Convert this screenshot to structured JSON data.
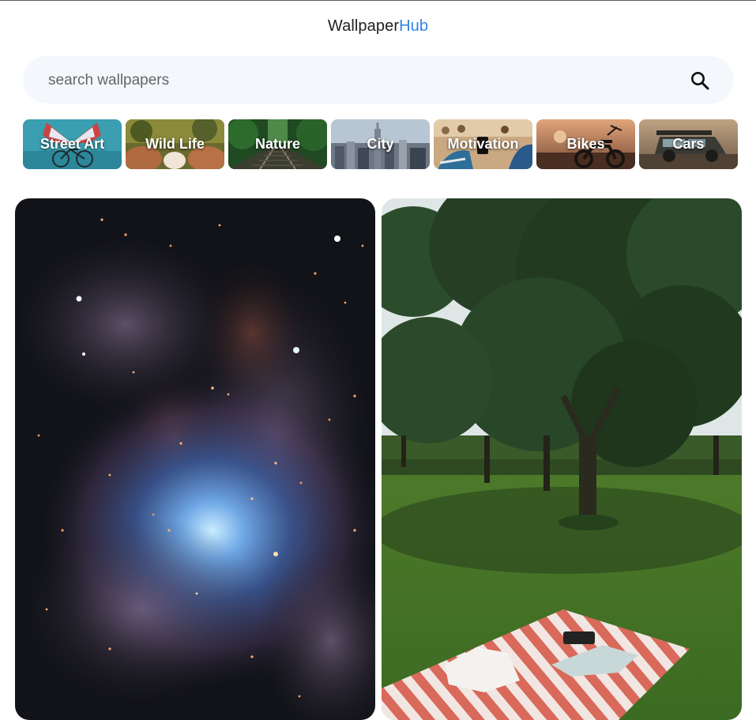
{
  "header": {
    "title_main": "Wallpaper",
    "title_accent": "Hub",
    "accent_color": "#2e86e6"
  },
  "search": {
    "placeholder": "search wallpapers",
    "value": "",
    "icon": "search-icon"
  },
  "categories": [
    {
      "label": "Street Art"
    },
    {
      "label": "Wild Life"
    },
    {
      "label": "Nature"
    },
    {
      "label": "City"
    },
    {
      "label": "Motivation"
    },
    {
      "label": "Bikes"
    },
    {
      "label": "Cars"
    }
  ],
  "wallpapers": [
    {
      "subject": "nebula"
    },
    {
      "subject": "park-picnic"
    }
  ]
}
